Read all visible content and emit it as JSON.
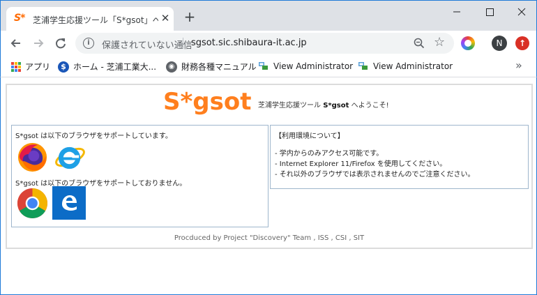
{
  "window": {
    "tab_title": "芝浦学生応援ツール「S*gsot」へようこそ！",
    "tab_favicon": "S*",
    "new_tab_symbol": "+",
    "controls": {
      "minimize": "minimize-icon",
      "maximize": "maximize-icon",
      "close": "close-icon"
    }
  },
  "toolbar": {
    "security_label": "保護されていない通信",
    "url": "sgsot.sic.shibaura-it.ac.jp",
    "profile_initial": "N"
  },
  "bookmarks": [
    {
      "label": "アプリ",
      "icon": "apps-icon"
    },
    {
      "label": "ホーム - 芝浦工業大...",
      "icon": "site-icon"
    },
    {
      "label": "財務各種マニュアル",
      "icon": "globe-icon"
    },
    {
      "label": "View Administrator",
      "icon": "admin-icon"
    },
    {
      "label": "View Administrator",
      "icon": "admin-icon"
    }
  ],
  "more_bookmarks_symbol": "»",
  "page": {
    "logo": "S*gsot",
    "welcome_prefix": "芝浦学生応援ツール ",
    "welcome_brand": "S*gsot",
    "welcome_suffix": " へようこそ!",
    "supported_text": "S*gsot は以下のブラウザをサポートしています。",
    "unsupported_text": "S*gsot は以下のブラウザをサポートしておりません。",
    "env_title": "【利用環境について】",
    "env_lines": [
      "- 学内からのみアクセス可能です。",
      "- Internet Explorer 11/Firefox を使用してください。",
      "- それ以外のブラウザでは表示されませんのでご注意ください。"
    ],
    "footer": "Procduced by Project \"Discovery\" Team , ISS , CSI , SIT",
    "supported_browsers": [
      "firefox-icon",
      "internet-explorer-icon"
    ],
    "unsupported_browsers": [
      "chrome-icon",
      "edge-icon"
    ]
  },
  "colors": {
    "logo": "#ff7f1e",
    "panel_border": "#9eb6cc",
    "window_frame": "#1e7ad8",
    "tabstrip": "#dee1e6"
  }
}
